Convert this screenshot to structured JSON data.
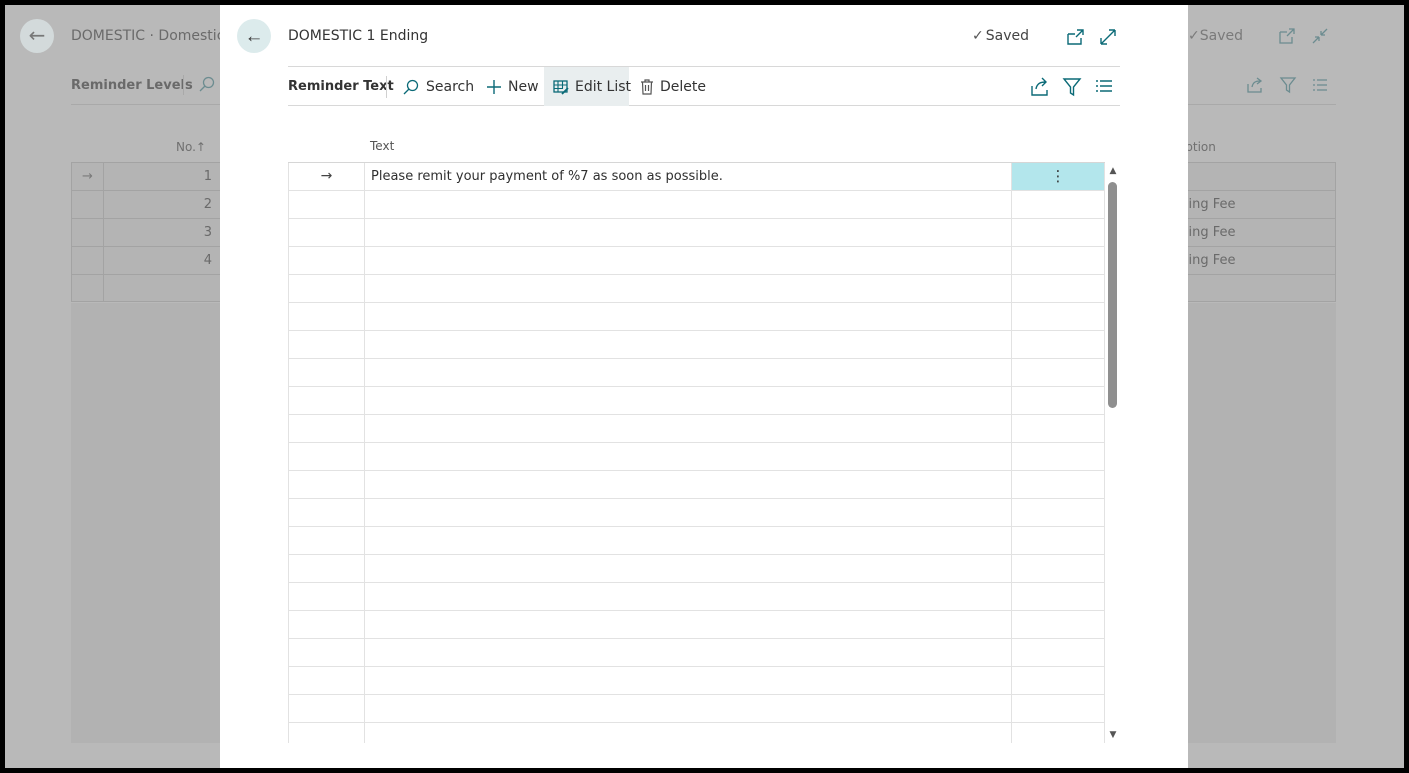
{
  "background": {
    "title": "DOMESTIC · Domestic C",
    "saved_label": "Saved",
    "toolbar_label": "Reminder Levels",
    "columns": {
      "no": "No.↑",
      "description": "ription"
    },
    "rows": [
      {
        "marker": "→",
        "no": "1",
        "description": ""
      },
      {
        "marker": "",
        "no": "2",
        "description": "ssing Fee"
      },
      {
        "marker": "",
        "no": "3",
        "description": "ssing Fee"
      },
      {
        "marker": "",
        "no": "4",
        "description": "ssing Fee"
      },
      {
        "marker": "",
        "no": "",
        "description": ""
      }
    ]
  },
  "modal": {
    "title": "DOMESTIC 1 Ending",
    "saved_label": "Saved",
    "toolbar": {
      "label": "Reminder Text",
      "search": "Search",
      "new": "New",
      "edit_list": "Edit List",
      "delete": "Delete"
    },
    "column_header": "Text",
    "rows": [
      {
        "marker": "→",
        "text": "Please remit your payment of %7 as soon as possible.",
        "action": "⋮"
      }
    ],
    "empty_row_count": 20
  },
  "colors": {
    "accent": "#0b6a77",
    "selected_cell": "#b3e6ec",
    "back_button": "#dcebec"
  }
}
